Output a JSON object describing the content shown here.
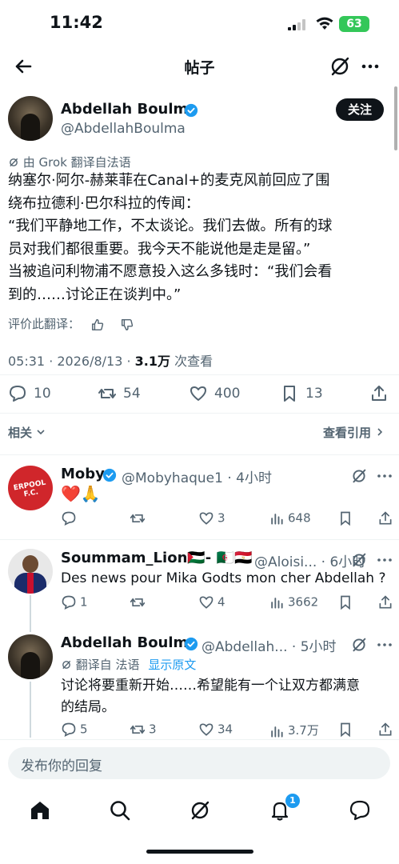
{
  "status_bar": {
    "time": "11:42",
    "battery": "63"
  },
  "header": {
    "title": "帖子"
  },
  "post": {
    "author_name": "Abdellah Boulma",
    "author_handle": "@AbdellahBoulma",
    "follow_label": "关注",
    "translated_label": "由 Grok 翻译自法语",
    "text_lines": [
      "纳塞尔·阿尔-赫莱菲在Canal+的麦克风前回应了围",
      "绕布拉德利·巴尔科拉的传闻：",
      "“我们平静地工作，不太谈论。我们去做。所有的球",
      "员对我们都很重要。我今天不能说他是走是留。”",
      "当被追问利物浦不愿意投入这么多钱时：“我们会看",
      "到的……讨论正在谈判中。”"
    ],
    "rate_label": "评价此翻译：",
    "time": "05:31 · 2026/8/13 · ",
    "views_count": "3.1万",
    "views_label": " 次查看",
    "replies": "10",
    "reposts": "54",
    "likes": "400",
    "bookmarks": "13",
    "related_label": "相关",
    "quotes_label": "查看引用"
  },
  "replies": [
    {
      "name": "Moby",
      "handle": "@Mobyhaque1 · 4小时",
      "text": "❤️🙏",
      "avatar_text": "ERPOOL F.C.",
      "replies": "",
      "reposts": "",
      "likes": "3",
      "views": "648"
    },
    {
      "name": "Soummam_Lion🇵🇸- 🇩🇿🇪🇬",
      "handle": "@Aloisi... · 6小时",
      "text": "Des news pour Mika Godts mon cher Abdellah ?",
      "replies": "1",
      "reposts": "",
      "likes": "4",
      "views": "3662"
    },
    {
      "name": "Abdellah Boulma",
      "handle": "@Abdellah... · 5小时",
      "translated_label": "翻译自 法语",
      "show_original": "显示原文",
      "text_lines": [
        "讨论将要重新开始……希望能有一个让双方都满意",
        "的结局。"
      ],
      "replies": "5",
      "reposts": "3",
      "likes": "34",
      "views": "3.7万"
    }
  ],
  "composer": {
    "placeholder": "发布你的回复"
  },
  "nav": {
    "notifications_badge": "1"
  }
}
